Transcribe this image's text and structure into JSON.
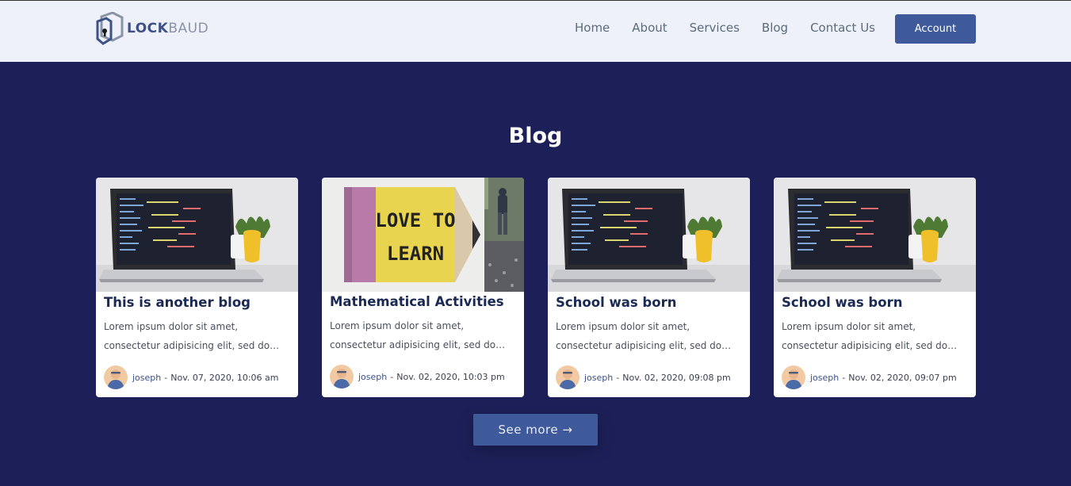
{
  "brand": {
    "logo_lock": "LOCK",
    "logo_baud": "BAUD"
  },
  "nav": {
    "items": [
      {
        "label": "Home"
      },
      {
        "label": "About"
      },
      {
        "label": "Services"
      },
      {
        "label": "Blog"
      },
      {
        "label": "Contact Us"
      }
    ],
    "account_label": "Account"
  },
  "main": {
    "title": "Blog",
    "cards": [
      {
        "title": "This is another blog",
        "excerpt": "Lorem ipsum dolor sit amet, consectetur adipisicing elit, sed do eiusmod tempor incididunt ut labore",
        "author": "joseph",
        "sep": "-",
        "date": "Nov. 07, 2020, 10:06 am",
        "image": "laptop-code"
      },
      {
        "title": "Mathematical Activities",
        "excerpt": "Lorem ipsum dolor sit amet, consectetur adipisicing elit, sed do eiusmod tempor incididunt ut labore",
        "author": "joseph",
        "sep": "-",
        "date": "Nov. 02, 2020, 10:03 pm",
        "image": "love-to-learn"
      },
      {
        "title": "School was born",
        "excerpt": "Lorem ipsum dolor sit amet, consectetur adipisicing elit, sed do eiusmod tempor incididunt ut labore",
        "author": "joseph",
        "sep": "-",
        "date": "Nov. 02, 2020, 09:08 pm",
        "image": "laptop-code"
      },
      {
        "title": "School was born",
        "excerpt": "Lorem ipsum dolor sit amet, consectetur adipisicing elit, sed do eiusmod tempor incididunt ut labore",
        "author": "joseph",
        "sep": "-",
        "date": "Nov. 02, 2020, 09:07 pm",
        "image": "laptop-code"
      }
    ],
    "love_sign": {
      "line1": "LOVE TO",
      "line2": "LEARN"
    },
    "see_more_label": "See more →"
  },
  "colors": {
    "background": "#1d2058",
    "navbar": "#eef1fa",
    "accent": "#3f5a9b",
    "title_text": "#1b2a55"
  }
}
